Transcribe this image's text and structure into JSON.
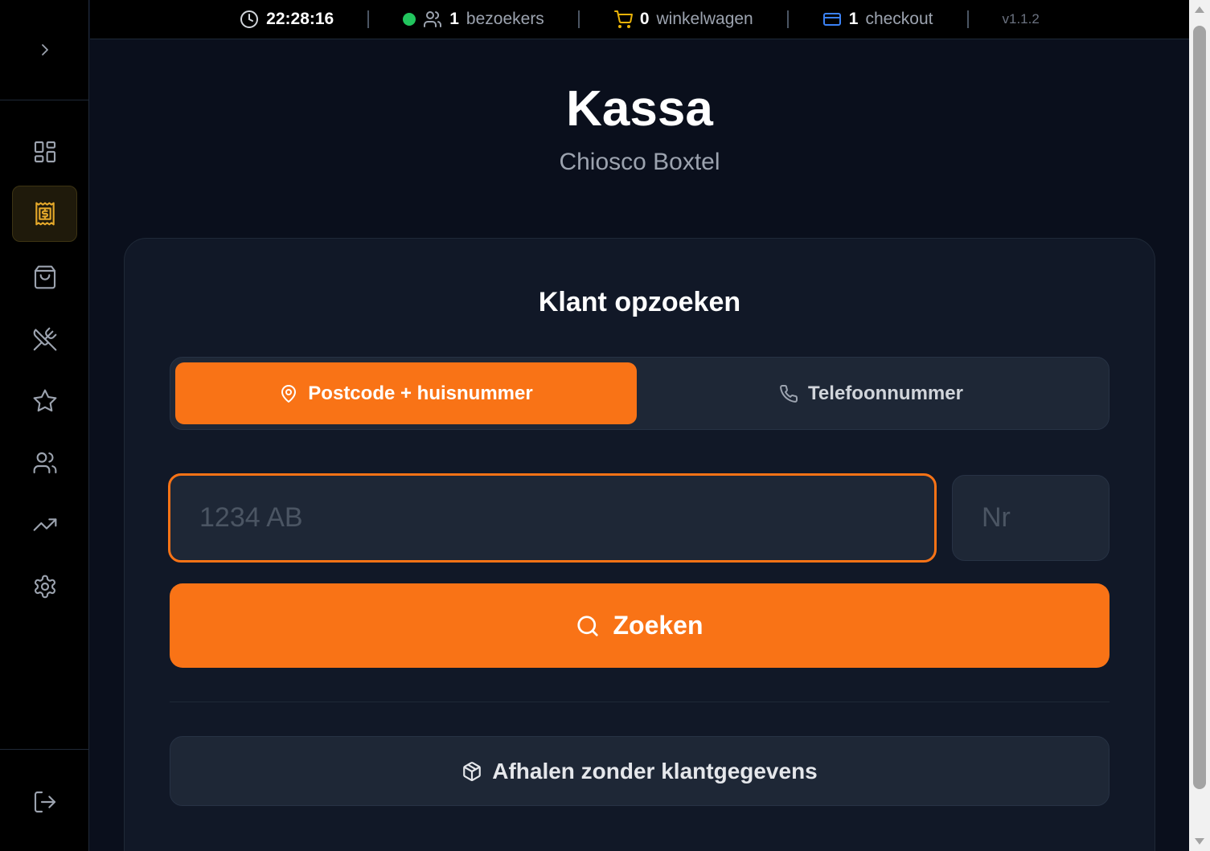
{
  "topbar": {
    "time": "22:28:16",
    "visitors_count": "1",
    "visitors_label": "bezoekers",
    "cart_count": "0",
    "cart_label": "winkelwagen",
    "checkout_count": "1",
    "checkout_label": "checkout",
    "version": "v1.1.2"
  },
  "sidebar": {
    "items": [
      {
        "icon": "dashboard-grid-icon"
      },
      {
        "icon": "cash-register-icon",
        "active": true
      },
      {
        "icon": "shopping-bag-icon"
      },
      {
        "icon": "utensils-crossed-icon"
      },
      {
        "icon": "star-icon"
      },
      {
        "icon": "users-icon"
      },
      {
        "icon": "trending-up-icon"
      },
      {
        "icon": "gear-icon"
      }
    ],
    "logout_icon": "logout-icon"
  },
  "page": {
    "title": "Kassa",
    "subtitle": "Chiosco Boxtel"
  },
  "lookup": {
    "title": "Klant opzoeken",
    "tabs": [
      {
        "label": "Postcode + huisnummer",
        "icon": "map-pin-icon",
        "active": true
      },
      {
        "label": "Telefoonnummer",
        "icon": "phone-icon",
        "active": false
      }
    ],
    "postcode_placeholder": "1234 AB",
    "postcode_value": "",
    "housenumber_placeholder": "Nr",
    "housenumber_value": "",
    "search_label": "Zoeken",
    "pickup_label": "Afhalen zonder klantgegevens"
  },
  "colors": {
    "accent": "#f97316",
    "active_nav": "#e4a82a",
    "online": "#22c55e",
    "cart": "#eab308",
    "checkout": "#3b82f6"
  }
}
